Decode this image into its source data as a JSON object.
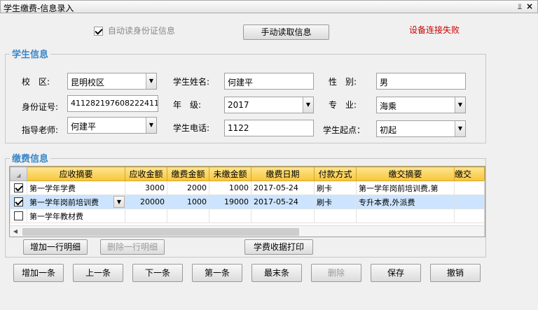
{
  "window": {
    "title": "学生缴费-信息录入",
    "pin_icon": "pin-icon",
    "close_icon": "close-icon"
  },
  "top": {
    "auto_read_label": "自动读身份证信息",
    "auto_read_checked": true,
    "manual_read_button": "手动读取信息",
    "device_status": "设备连接失败",
    "device_status_color": "#cc0000"
  },
  "student": {
    "section_title": "学生信息",
    "campus_label": "校　区:",
    "campus_value": "昆明校区",
    "name_label": "学生姓名:",
    "name_value": "何建平",
    "gender_label": "性　别:",
    "gender_value": "男",
    "id_label": "身份证号:",
    "id_value": "411282197608222411",
    "grade_label": "年　级:",
    "grade_value": "2017",
    "major_label": "专　业:",
    "major_value": "海乘",
    "teacher_label": "指导老师:",
    "teacher_value": "何建平",
    "phone_label": "学生电话:",
    "phone_value": "1122",
    "start_label": "学生起点：",
    "start_value": "初起"
  },
  "payment": {
    "section_title": "缴费信息",
    "columns": [
      "应收摘要",
      "应收金额",
      "缴费金额",
      "未缴金额",
      "缴费日期",
      "付款方式",
      "缴交摘要",
      "缴交"
    ],
    "rows": [
      {
        "checked": true,
        "summary": "第一学年学费",
        "receivable": "3000",
        "paid": "2000",
        "unpaid": "1000",
        "date": "2017-05-24",
        "method": "刷卡",
        "note": "第一学年岗前培训费,第",
        "selected": false
      },
      {
        "checked": true,
        "summary": "第一学年岗前培训费",
        "receivable": "20000",
        "paid": "1000",
        "unpaid": "19000",
        "date": "2017-05-24",
        "method": "刷卡",
        "note": "专升本费,外派费",
        "selected": true
      },
      {
        "checked": false,
        "summary": "第一学年教材费",
        "receivable": "",
        "paid": "",
        "unpaid": "",
        "date": "",
        "method": "",
        "note": "",
        "selected": false
      }
    ],
    "add_row_button": "增加一行明细",
    "delete_row_button": "删除一行明细",
    "print_button": "学费收据打印"
  },
  "bottom_buttons": {
    "add": "增加一条",
    "prev": "上一条",
    "next": "下一条",
    "first": "第一条",
    "last": "最末条",
    "delete": "删除",
    "save": "保存",
    "cancel": "撤销"
  },
  "colors": {
    "section_title": "#3a87c8",
    "grid_header": "#f8c53d",
    "selected_row": "#cce4ff"
  }
}
